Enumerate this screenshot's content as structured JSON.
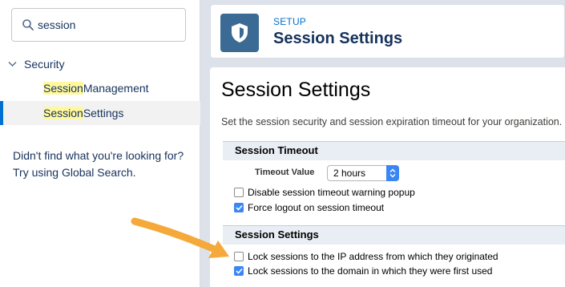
{
  "search": {
    "value": "session",
    "icon": "search-icon"
  },
  "tree": {
    "root_label": "Security",
    "items": [
      {
        "highlight": "Session",
        "rest": " Management",
        "selected": false
      },
      {
        "highlight": "Session",
        "rest": " Settings",
        "selected": true
      }
    ]
  },
  "help": {
    "line1": "Didn't find what you're looking for?",
    "line2": "Try using Global Search."
  },
  "header": {
    "breadcrumb": "SETUP",
    "title": "Session Settings"
  },
  "page": {
    "title": "Session Settings",
    "description": "Set the session security and session expiration timeout for your organization."
  },
  "timeout_section": {
    "heading": "Session Timeout",
    "timeout_label": "Timeout Value",
    "timeout_value": "2 hours",
    "checkboxes": [
      {
        "label": "Disable session timeout warning popup",
        "checked": false
      },
      {
        "label": "Force logout on session timeout",
        "checked": true
      }
    ]
  },
  "settings_section": {
    "heading": "Session Settings",
    "checkboxes": [
      {
        "label": "Lock sessions to the IP address from which they originated",
        "checked": false
      },
      {
        "label": "Lock sessions to the domain in which they were first used",
        "checked": true
      }
    ]
  },
  "colors": {
    "accent": "#0070d2",
    "highlight": "#fff89e",
    "checkbox": "#3b86f5",
    "arrow": "#f4a93a"
  }
}
